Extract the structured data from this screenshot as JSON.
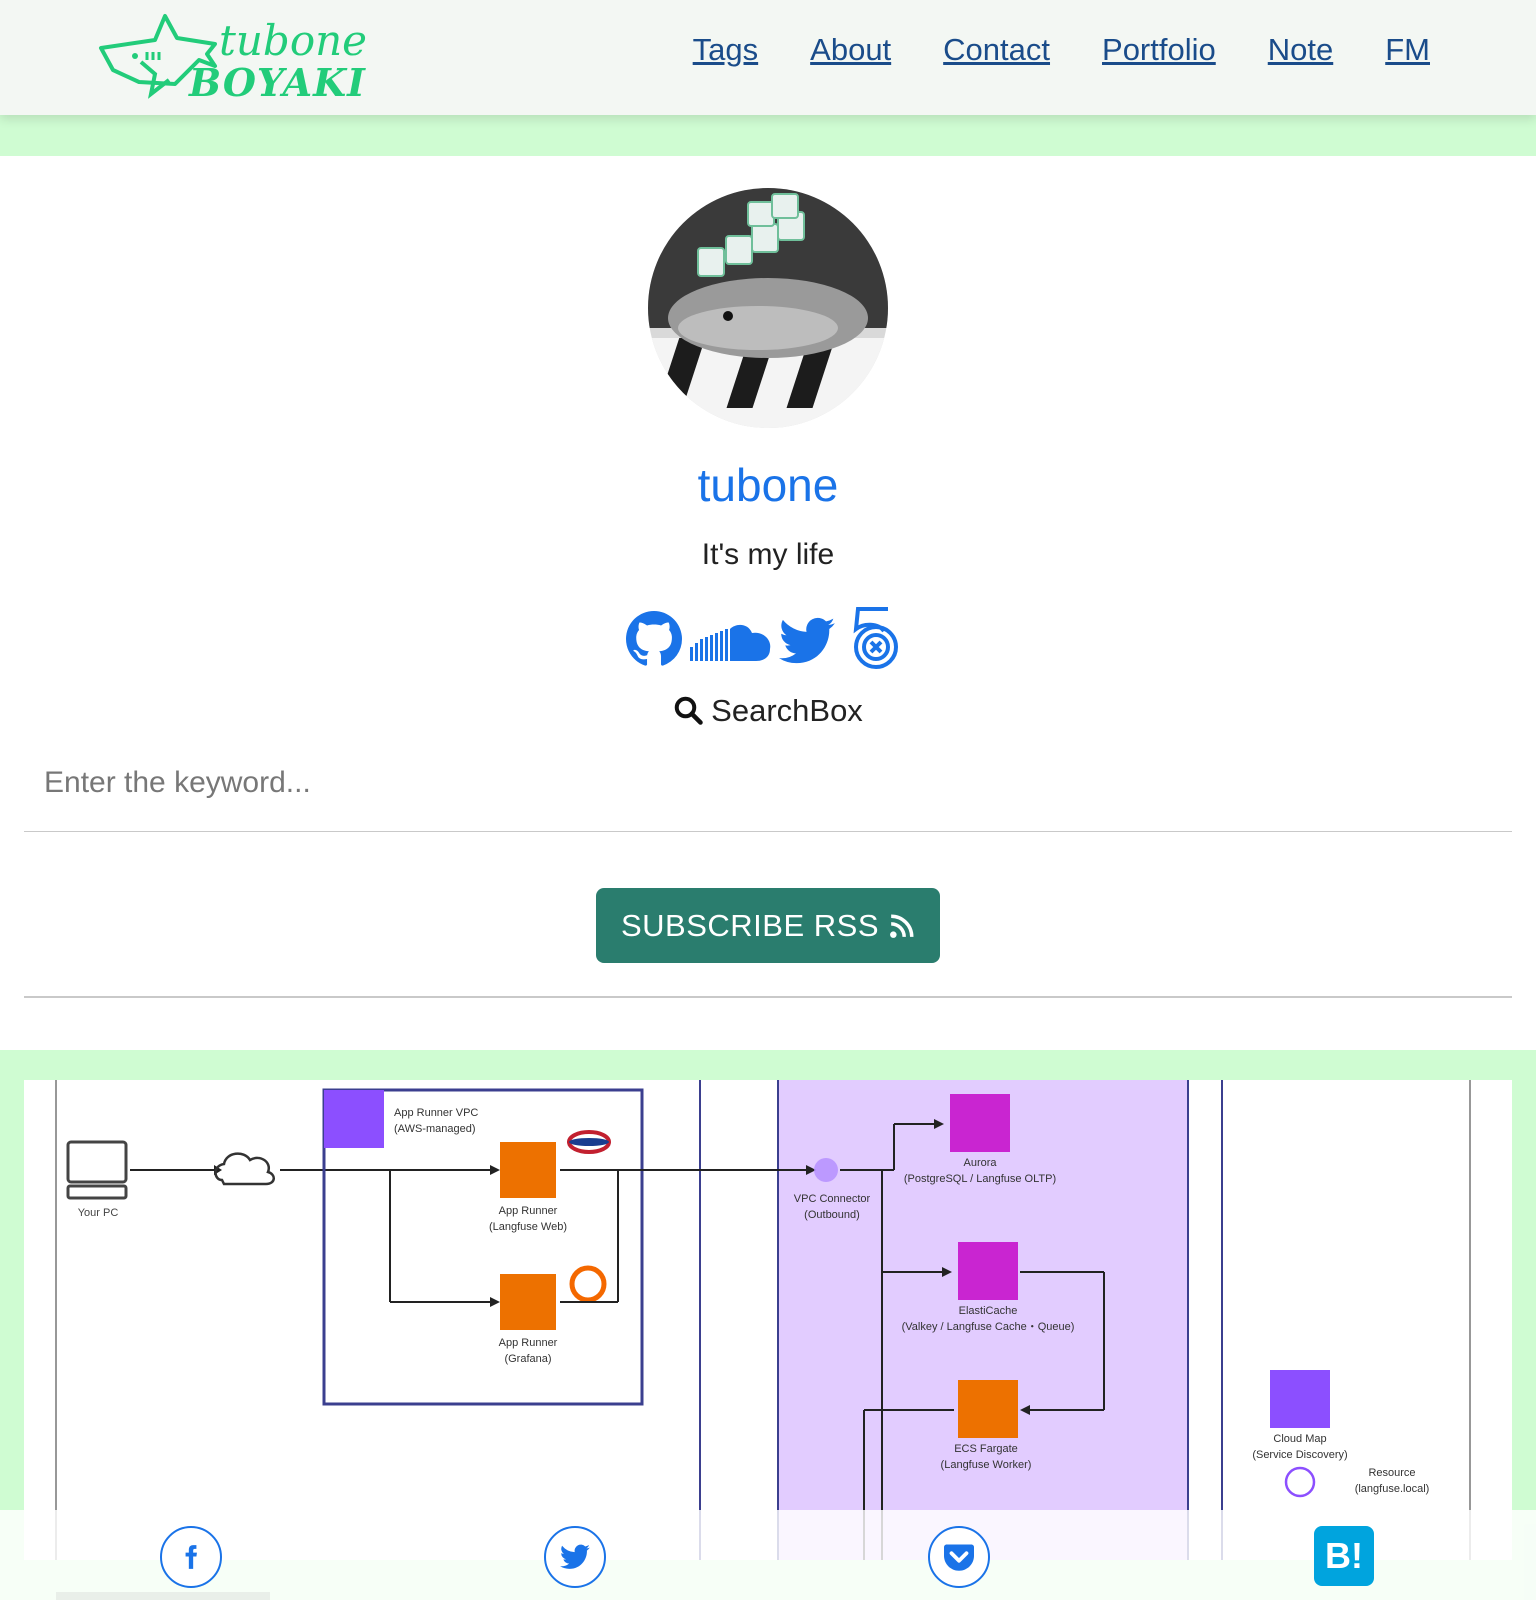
{
  "header": {
    "logo_top": "tubone",
    "logo_bottom": "BOYAKI",
    "nav": [
      "Tags",
      "About",
      "Contact",
      "Portfolio",
      "Note",
      "FM"
    ]
  },
  "profile": {
    "name": "tubone",
    "tagline": "It's my life",
    "social_icons": [
      "github-icon",
      "soundcloud-icon",
      "twitter-icon",
      "500px-icon"
    ]
  },
  "search": {
    "label": "SearchBox",
    "placeholder": "Enter the keyword..."
  },
  "rss": {
    "label": "SUBSCRIBE RSS"
  },
  "diagram": {
    "your_pc": "Your PC",
    "vpc_title_1": "App Runner VPC",
    "vpc_title_2": "(AWS-managed)",
    "app_runner_web_1": "App Runner",
    "app_runner_web_2": "(Langfuse Web)",
    "app_runner_graf_1": "App Runner",
    "app_runner_graf_2": "(Grafana)",
    "vpc_conn_1": "VPC Connector",
    "vpc_conn_2": "(Outbound)",
    "aurora_1": "Aurora",
    "aurora_2": "(PostgreSQL / Langfuse OLTP)",
    "elasticache_1": "ElastiCache",
    "elasticache_2": "(Valkey / Langfuse Cache・Queue)",
    "ecs_1": "ECS Fargate",
    "ecs_2": "(Langfuse Worker)",
    "cloudmap_1": "Cloud Map",
    "cloudmap_2": "(Service Discovery)",
    "resource_1": "Resource",
    "resource_2": "(langfuse.local)"
  },
  "share": {
    "hatena_label": "B!"
  },
  "colors": {
    "accent_green": "#22cc7a",
    "nav_link": "#1a4c8a",
    "name_blue": "#1a73e8",
    "rss_button": "#2a7d6e",
    "page_bg": "#cffcd2"
  }
}
